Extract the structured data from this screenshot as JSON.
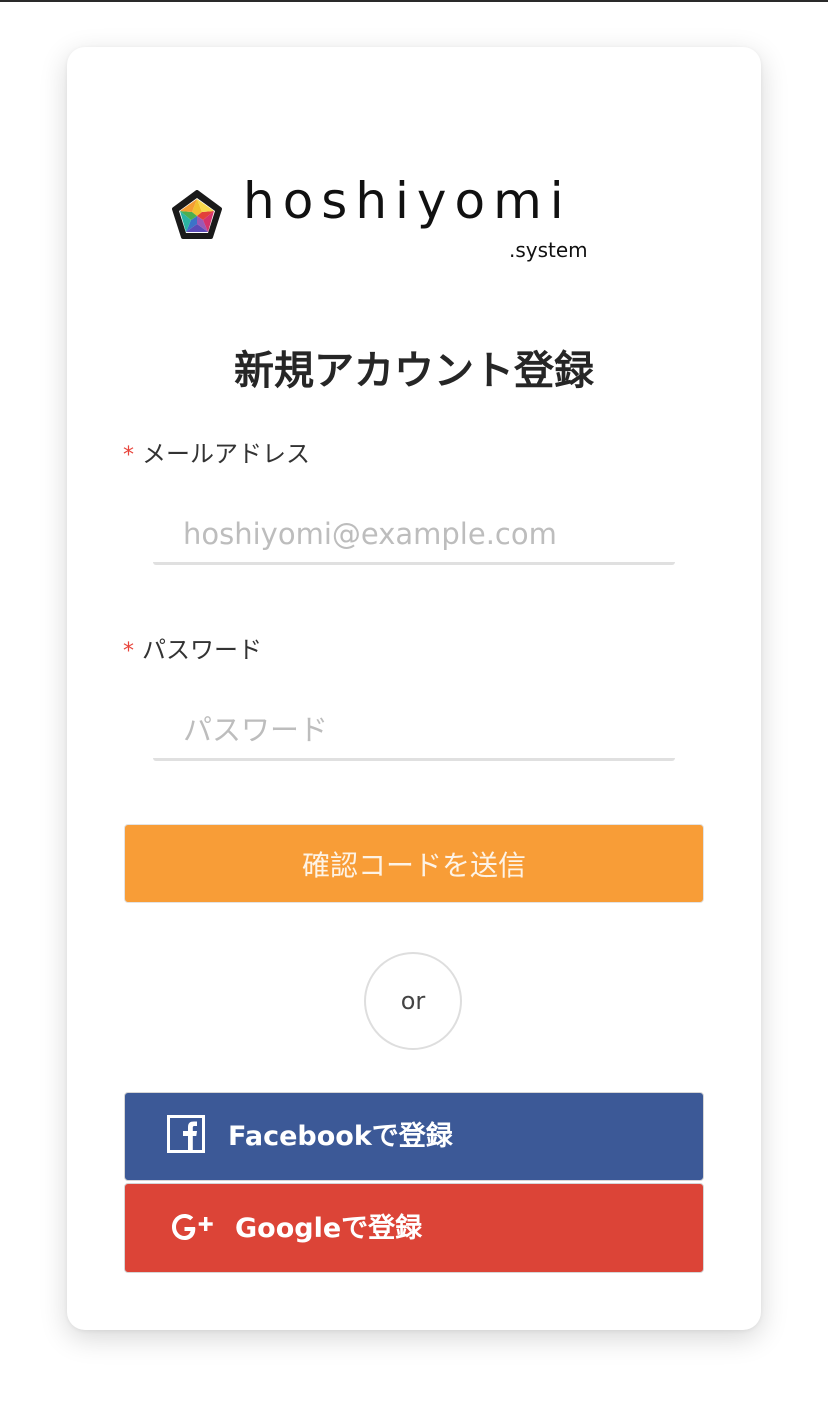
{
  "brand": {
    "name": "hoshiyomi",
    "suffix": ".system"
  },
  "page": {
    "title": "新規アカウント登録"
  },
  "form": {
    "email": {
      "required_mark": "*",
      "label": "メールアドレス",
      "value": "",
      "placeholder": "hoshiyomi@example.com"
    },
    "password": {
      "required_mark": "*",
      "label": "パスワード",
      "value": "",
      "placeholder": "パスワード"
    },
    "send_code_label": "確認コードを送信"
  },
  "divider": {
    "label": "or"
  },
  "social": {
    "facebook_label": "Facebookで登録",
    "google_label": "Googleで登録"
  },
  "colors": {
    "send_button": "#f89d37",
    "facebook": "#3c5997",
    "google": "#dc4437",
    "required_mark": "#e8453c"
  },
  "icons": {
    "logo": "star-pentagon-logo-icon",
    "facebook": "facebook-icon",
    "google": "google-plus-icon"
  }
}
